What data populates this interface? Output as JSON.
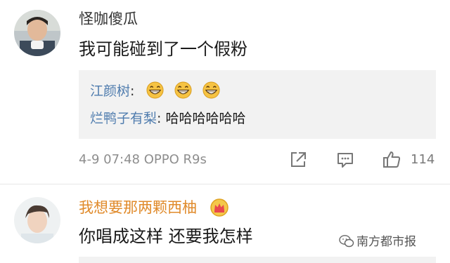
{
  "comments": [
    {
      "username": "怪咖傻瓜",
      "username_color": "#333333",
      "text": "我可能碰到了一个假粉",
      "replies": [
        {
          "name": "江颜树",
          "colon": ":",
          "emojis": [
            "grin-emoji",
            "grin-emoji",
            "grin-emoji"
          ]
        },
        {
          "name": "烂鸭子有梨",
          "colon": ":",
          "text": "哈哈哈哈哈哈"
        }
      ],
      "meta": "4-9 07:48  OPPO R9s",
      "like_count": "114",
      "icons": [
        "share-icon",
        "comment-icon",
        "thumbs-up-icon"
      ]
    },
    {
      "username": "我想要那两颗西柚",
      "username_color": "#e08a2a",
      "badge_icon": "crown-badge-icon",
      "text": "你唱成这样 还要我怎样"
    }
  ],
  "watermark": {
    "icon": "wechat-icon",
    "text": "南方都市报"
  },
  "colors": {
    "reply_name": "#4f7cae",
    "reply_background": "#f2f2f2",
    "meta_text": "#8e8e8e"
  }
}
